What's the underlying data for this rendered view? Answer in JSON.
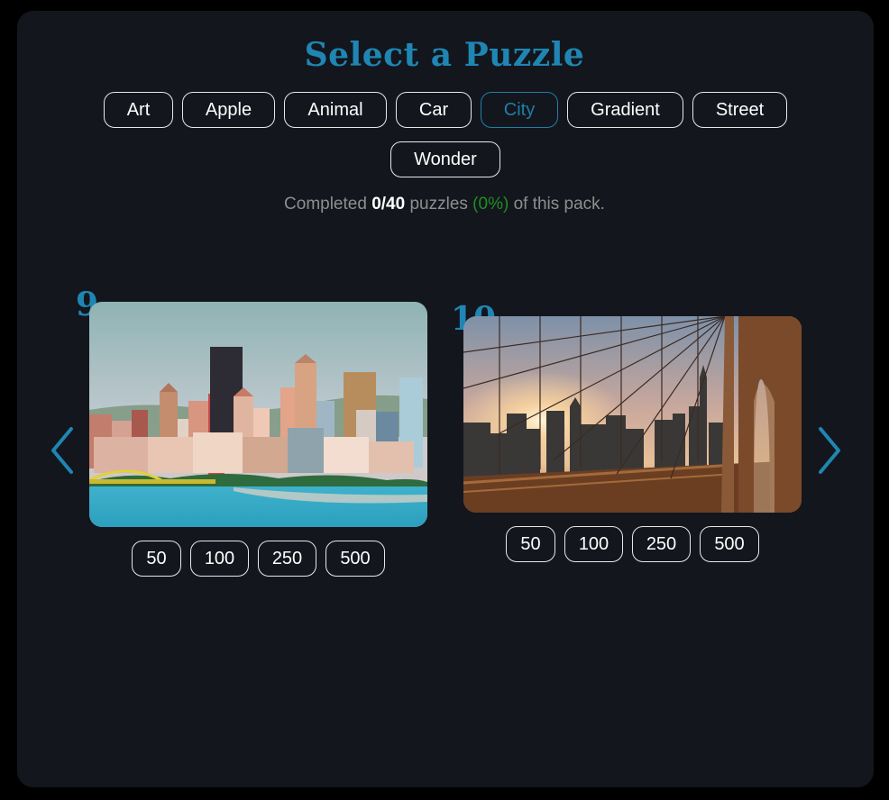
{
  "title": "Select a Puzzle",
  "categories": [
    {
      "label": "Art"
    },
    {
      "label": "Apple"
    },
    {
      "label": "Animal"
    },
    {
      "label": "Car"
    },
    {
      "label": "City"
    },
    {
      "label": "Gradient"
    },
    {
      "label": "Street"
    },
    {
      "label": "Wonder"
    }
  ],
  "active_category": "City",
  "progress": {
    "prefix": "Completed",
    "count": "0/40",
    "middle": "puzzles",
    "percent": "(0%)",
    "suffix": "of this pack."
  },
  "puzzles": [
    {
      "number": "9",
      "image": "Pittsburgh skyline over river",
      "sizes": [
        "50",
        "100",
        "250",
        "500"
      ]
    },
    {
      "number": "10",
      "image": "Brooklyn Bridge cables with Manhattan skyline at sunset",
      "sizes": [
        "50",
        "100",
        "250",
        "500"
      ]
    }
  ],
  "nav": {
    "prev_icon": "chevron-left-icon",
    "next_icon": "chevron-right-icon"
  },
  "colors": {
    "accent": "#1f86b3",
    "panel": "#13161d",
    "success": "#1f8f1f"
  }
}
